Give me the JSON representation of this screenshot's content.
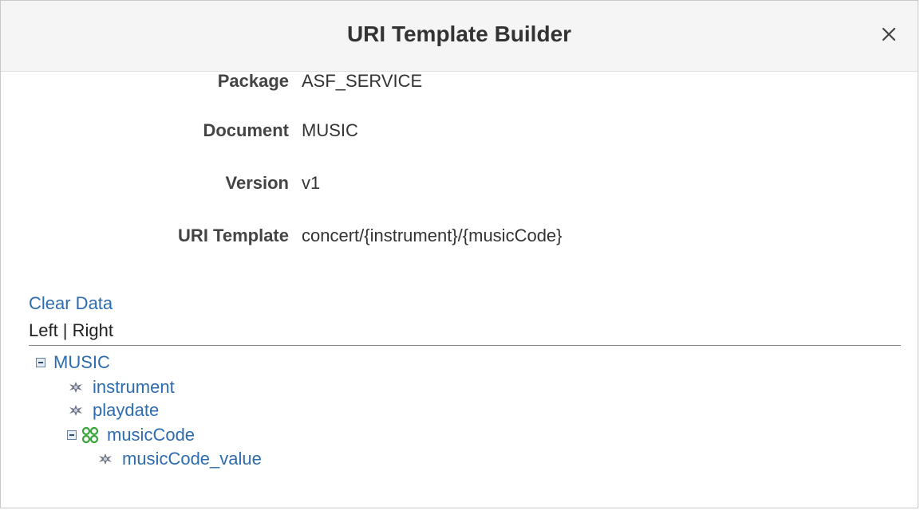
{
  "dialog": {
    "title": "URI Template Builder",
    "close_icon": "close-icon"
  },
  "fields": [
    {
      "label": "Package",
      "value": "ASF_SERVICE"
    },
    {
      "label": "Document",
      "value": "MUSIC"
    },
    {
      "label": "Version",
      "value": "v1"
    },
    {
      "label": "URI Template",
      "value": "concert/{instrument}/{musicCode}"
    }
  ],
  "actions": {
    "clear_data": "Clear Data",
    "view_toggle": "Left | Right"
  },
  "tree": {
    "root": {
      "label": "MUSIC",
      "icon": "collapse-icon"
    },
    "children": [
      {
        "label": "instrument",
        "icon": "primitive-element-icon"
      },
      {
        "label": "playdate",
        "icon": "primitive-element-icon"
      },
      {
        "label": "musicCode",
        "icon": "compound-element-icon",
        "children": [
          {
            "label": "musicCode_value",
            "icon": "primitive-element-icon"
          }
        ]
      }
    ]
  },
  "colors": {
    "link": "#2d6cae",
    "header_bg": "#f5f5f5",
    "compound_icon": "#3aa33a"
  }
}
